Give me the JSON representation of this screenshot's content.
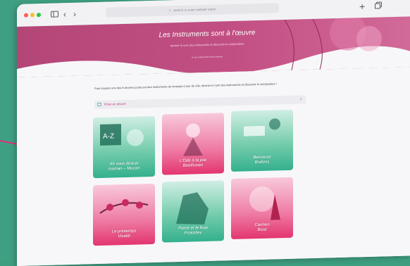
{
  "browser": {
    "address_placeholder": "Search or enter website name"
  },
  "banner": {
    "title": "Les Instruments sont à l'œuvre",
    "subtitle": "deviner le nom des instruments et découvrir le compositeur",
    "meta": "➡ Les instruments sont à l'œuvre"
  },
  "intro_text": "Pour écouter une des 6 œuvres jouée par des instruments de musique à tour de rôle, deviner le nom des instruments et découvrir le compositeur !",
  "section": {
    "label": "Prise en œuvre"
  },
  "cards": [
    {
      "title": "Ah vous dirai-je",
      "subtitle": "maman – Mozart",
      "color": "#34b08e"
    },
    {
      "title": "L'Ode à la joie",
      "subtitle": "Beethoven",
      "color": "#e3356f"
    },
    {
      "title": "Berceuse",
      "subtitle": "Brahms",
      "color": "#34b08e"
    },
    {
      "title": "Le printemps",
      "subtitle": "Vivaldi",
      "color": "#e3356f"
    },
    {
      "title": "Pierre et le loup",
      "subtitle": "Prokofiev",
      "color": "#34b08e"
    },
    {
      "title": "Carmen",
      "subtitle": "Bizet",
      "color": "#e3356f"
    }
  ],
  "colors": {
    "accent_pink": "#c13b74",
    "accent_green": "#34b08e"
  }
}
